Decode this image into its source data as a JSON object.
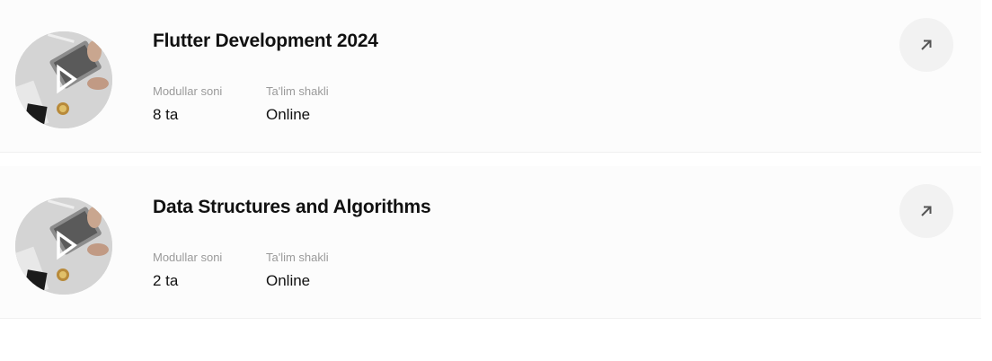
{
  "courses": [
    {
      "title": "Flutter Development 2024",
      "modules_label": "Modullar soni",
      "modules_value": "8 ta",
      "format_label": "Ta'lim shakli",
      "format_value": "Online",
      "thumbnail_icon": "play-icon",
      "action_icon": "arrow-up-right-icon"
    },
    {
      "title": "Data Structures and Algorithms",
      "modules_label": "Modullar soni",
      "modules_value": "2 ta",
      "format_label": "Ta'lim shakli",
      "format_value": "Online",
      "thumbnail_icon": "play-icon",
      "action_icon": "arrow-up-right-icon"
    }
  ],
  "colors": {
    "card_background": "#fcfcfc",
    "title_text": "#111111",
    "label_text": "#9a9a9a",
    "button_background": "#f2f2f2"
  }
}
